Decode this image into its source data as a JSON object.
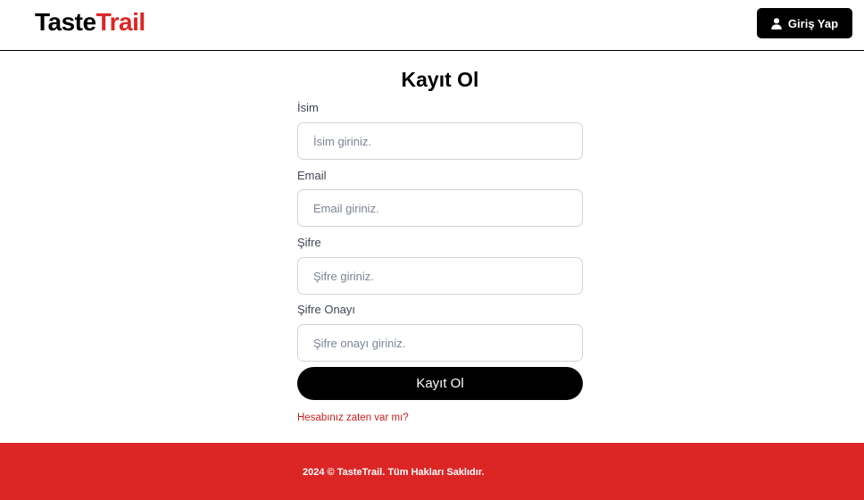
{
  "header": {
    "logo_part1": "Taste",
    "logo_part2": "Trail",
    "login_button_label": "Giriş Yap",
    "login_button_icon": "user-icon"
  },
  "form": {
    "title": "Kayıt Ol",
    "fields": [
      {
        "label": "İsim",
        "placeholder": "İsim giriniz.",
        "value": ""
      },
      {
        "label": "Email",
        "placeholder": "Email giriniz.",
        "value": ""
      },
      {
        "label": "Şifre",
        "placeholder": "Şifre giriniz.",
        "value": ""
      },
      {
        "label": "Şifre Onayı",
        "placeholder": "Şifre onayı giriniz.",
        "value": ""
      }
    ],
    "submit_label": "Kayıt Ol",
    "login_link": "Hesabınız zaten var mı?"
  },
  "footer": {
    "text": "2024 © TasteTrail. Tüm Hakları Saklıdır."
  },
  "colors": {
    "brand_red": "#dc2626",
    "primary_black": "#000000"
  }
}
